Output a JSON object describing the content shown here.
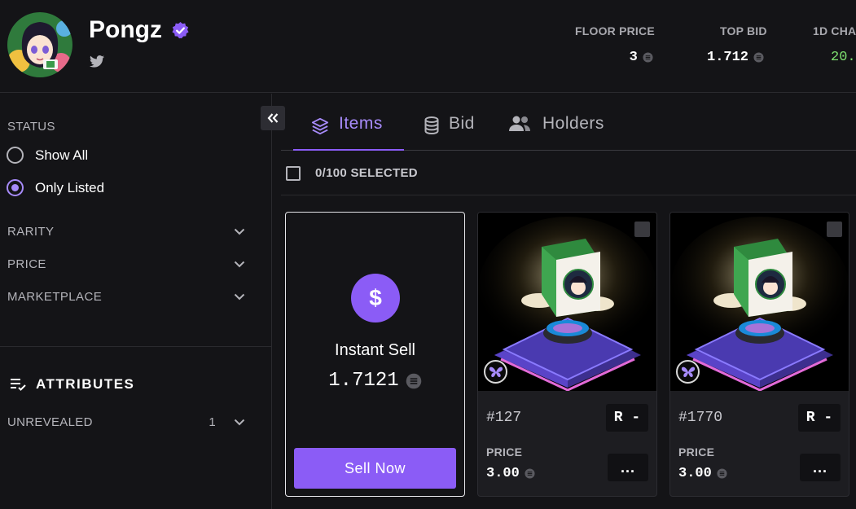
{
  "collection": {
    "name": "Pongz",
    "verified_icon": "verified-badge-icon",
    "social_icon": "twitter-icon"
  },
  "stats": [
    {
      "label": "FLOOR PRICE",
      "value": "3"
    },
    {
      "label": "TOP BID",
      "value": "1.712"
    },
    {
      "label": "1D CHA",
      "value": "20."
    }
  ],
  "sidebar": {
    "status_title": "STATUS",
    "status_options": [
      {
        "label": "Show All",
        "selected": false
      },
      {
        "label": "Only Listed",
        "selected": true
      }
    ],
    "filters": [
      {
        "label": "RARITY"
      },
      {
        "label": "PRICE"
      },
      {
        "label": "MARKETPLACE"
      }
    ],
    "attributes_title": "ATTRIBUTES",
    "attributes": [
      {
        "label": "UNREVEALED",
        "count": "1"
      }
    ]
  },
  "tabs": [
    {
      "label": "Items",
      "icon": "layers-icon",
      "active": true
    },
    {
      "label": "Bid",
      "icon": "database-icon",
      "active": false
    },
    {
      "label": "Holders",
      "icon": "users-icon",
      "active": false
    }
  ],
  "selection": {
    "text": "0/100 SELECTED"
  },
  "instant_sell": {
    "title": "Instant Sell",
    "price": "1.7121",
    "button": "Sell Now",
    "icon_glyph": "$"
  },
  "items": [
    {
      "id": "#127",
      "rank": "R -",
      "price_label": "PRICE",
      "price": "3.00",
      "more": "..."
    },
    {
      "id": "#1770",
      "rank": "R -",
      "price_label": "PRICE",
      "price": "3.00",
      "more": "..."
    }
  ],
  "colors": {
    "accent": "#8b5cf6",
    "accent_light": "#a78bfa",
    "positive": "#7ee06f",
    "background": "#141417"
  }
}
